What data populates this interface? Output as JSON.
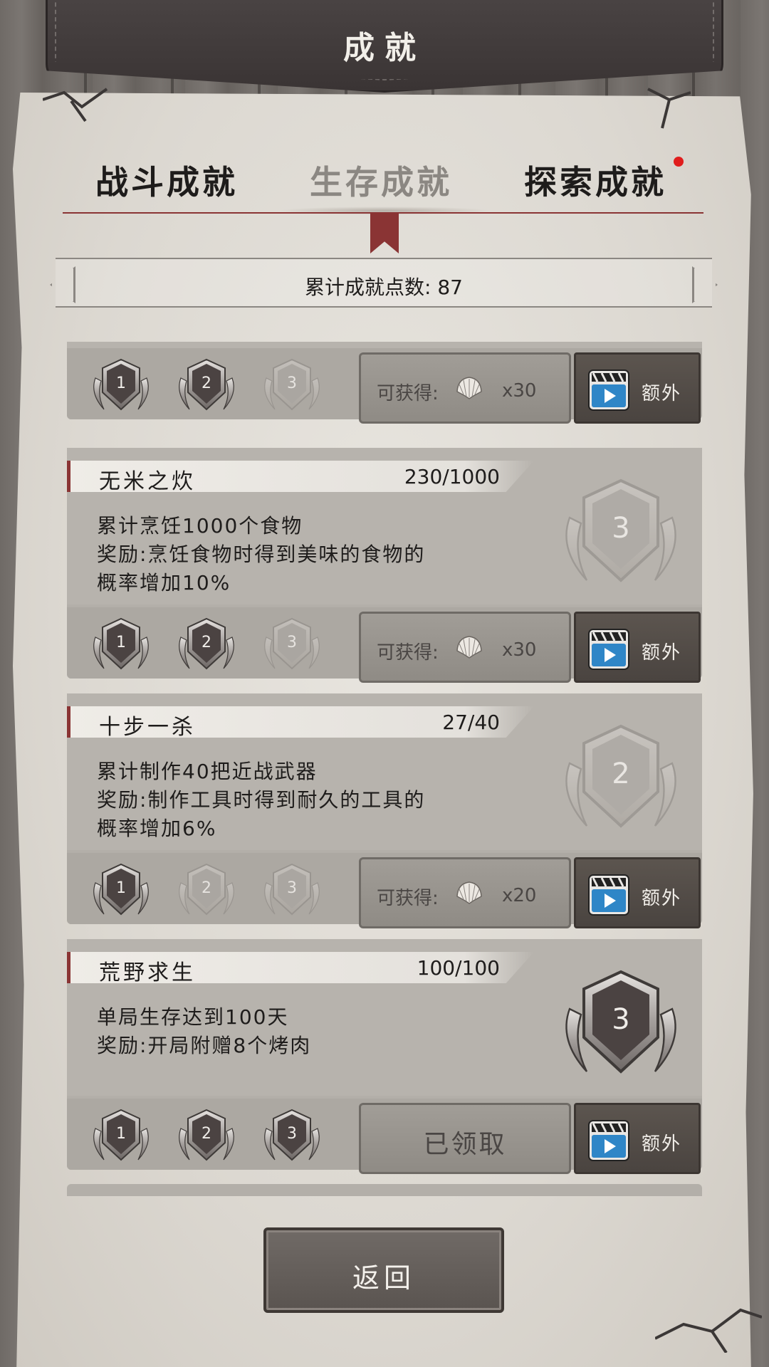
{
  "header": {
    "title": "成就"
  },
  "tabs": [
    {
      "label": "战斗成就",
      "active": false,
      "has_notification": false
    },
    {
      "label": "生存成就",
      "active": true,
      "has_notification": false
    },
    {
      "label": "探索成就",
      "active": false,
      "has_notification": true
    }
  ],
  "points": {
    "text": "累计成就点数: 87"
  },
  "achievements": [
    {
      "name": "",
      "progress": "",
      "description": [],
      "tier_badges": [
        "1",
        "2",
        "3"
      ],
      "tiers_earned": 2,
      "reward_label": "可获得:",
      "reward_icon": "shell-icon",
      "reward_count": "x30",
      "extra_label": "额外"
    },
    {
      "name": "无米之炊",
      "progress": "230/1000",
      "current_badge": "3",
      "description": [
        "累计烹饪1000个食物",
        "奖励:烹饪食物时得到美味的食物的",
        "概率增加10%"
      ],
      "tier_badges": [
        "1",
        "2",
        "3"
      ],
      "tiers_earned": 2,
      "reward_label": "可获得:",
      "reward_icon": "shell-icon",
      "reward_count": "x30",
      "extra_label": "额外"
    },
    {
      "name": "十步一杀",
      "progress": "27/40",
      "current_badge": "2",
      "description": [
        "累计制作40把近战武器",
        "奖励:制作工具时得到耐久的工具的",
        "概率增加6%"
      ],
      "tier_badges": [
        "1",
        "2",
        "3"
      ],
      "tiers_earned": 1,
      "reward_label": "可获得:",
      "reward_icon": "shell-icon",
      "reward_count": "x20",
      "extra_label": "额外"
    },
    {
      "name": "荒野求生",
      "progress": "100/100",
      "current_badge": "3",
      "description": [
        "单局生存达到100天",
        "奖励:开局附赠8个烤肉"
      ],
      "tier_badges": [
        "1",
        "2",
        "3"
      ],
      "tiers_earned": 3,
      "claimed_label": "已领取",
      "extra_label": "额外"
    }
  ],
  "footer": {
    "back_label": "返回"
  },
  "colors": {
    "accent_red": "#8a3434",
    "notification": "#e01d1d",
    "badge_dark": "#4b4342"
  }
}
